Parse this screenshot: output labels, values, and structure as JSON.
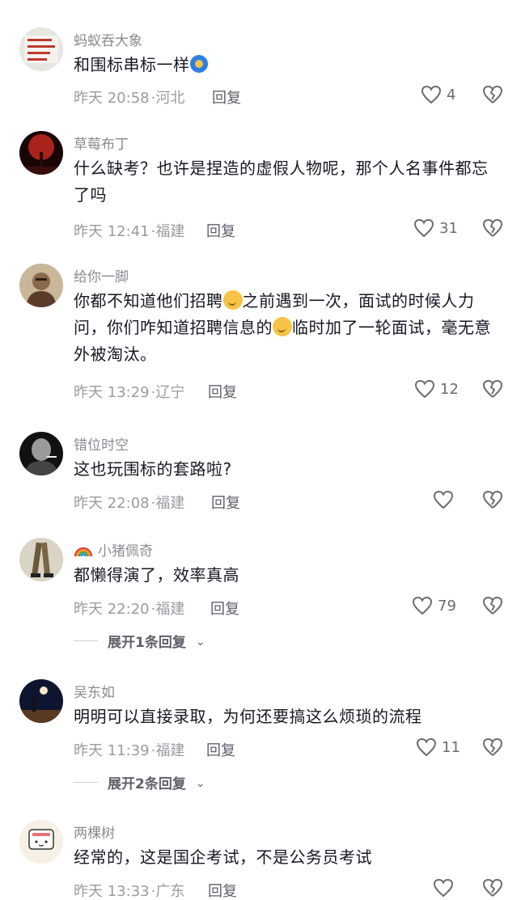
{
  "comments": [
    {
      "username": "蚂蚁吞大象",
      "text_before": "和围标串标一样",
      "time": "昨天 20:58",
      "location": "河北",
      "reply": "回复",
      "likes": "4",
      "avatar_icon": "sign-text-avatar"
    },
    {
      "username": "草莓布丁",
      "text": "什么缺考？也许是捏造的虚假人物呢，那个人名事件都忘了吗",
      "time": "昨天 12:41",
      "location": "福建",
      "reply": "回复",
      "likes": "31",
      "avatar_icon": "red-tree-avatar"
    },
    {
      "username": "给你一脚",
      "text_part1": "你都不知道他们招聘",
      "text_part2": "之前遇到一次，面试的时候人力问，你们咋知道招聘信息的",
      "text_part3": "临时加了一轮面试，毫无意外被淘汰。",
      "time": "昨天 13:29",
      "location": "辽宁",
      "reply": "回复",
      "likes": "12",
      "avatar_icon": "person-photo-avatar"
    },
    {
      "username": "错位时空",
      "text": "这也玩围标的套路啦?",
      "time": "昨天 22:08",
      "location": "福建",
      "reply": "回复",
      "likes": "",
      "avatar_icon": "bw-portrait-avatar"
    },
    {
      "username": "小猪佩奇",
      "text": "都懒得演了，效率真高",
      "time": "昨天 22:20",
      "location": "福建",
      "reply": "回复",
      "likes": "79",
      "expand": "展开1条回复",
      "avatar_icon": "legs-photo-avatar"
    },
    {
      "username": "吴东如",
      "text": "明明可以直接录取，为何还要搞这么烦琐的流程",
      "time": "昨天 11:39",
      "location": "福建",
      "reply": "回复",
      "likes": "11",
      "expand": "展开2条回复",
      "avatar_icon": "night-sky-avatar"
    },
    {
      "username": "两棵树",
      "text": "经常的，这是国企考试，不是公务员考试",
      "time": "昨天 13:33",
      "location": "广东",
      "reply": "回复",
      "likes": "",
      "avatar_icon": "cartoon-avatar"
    }
  ],
  "colors": {
    "username": "#8a8b91",
    "text": "#161823",
    "meta": "#9a9ba1"
  }
}
